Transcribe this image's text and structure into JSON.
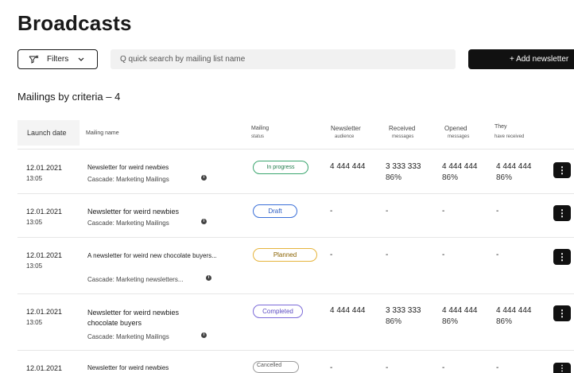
{
  "page": {
    "title": "Broadcasts"
  },
  "toolbar": {
    "filters_label": "Filters",
    "search_placeholder": "Q quick search by mailing list name",
    "add_label": "+ Add newsletter"
  },
  "section": {
    "title": "Mailings by criteria – 4"
  },
  "table": {
    "headers": {
      "launch": "Launch date",
      "name": "Mailing name",
      "status_1": "Mailing",
      "status_2": "status",
      "audience_1": "Newsletter",
      "audience_2": "audience",
      "received_1": "Received",
      "received_2": "messages",
      "opened_1": "Opened",
      "opened_2": "messages",
      "they_1": "They",
      "they_2": "have received"
    },
    "rows": [
      {
        "date": "12.01.2021",
        "time": "13:05",
        "name": "Newsletter for weird newbies",
        "cascade": "Cascade: Marketing Mailings",
        "status": "In progress",
        "audience": "4 444 444",
        "received": "3 333 333",
        "received_pct": "86%",
        "opened": "4 444 444",
        "opened_pct": "86%",
        "they": "4 444 444",
        "they_pct": "86%"
      },
      {
        "date": "12.01.2021",
        "time": "13:05",
        "name": "Newsletter for weird newbies",
        "cascade": "Cascade: Marketing Mailings",
        "status": "Draft",
        "audience": "-",
        "received": "-",
        "opened": "-",
        "they": "-"
      },
      {
        "date": "12.01.2021",
        "time": "13:05",
        "name": "A newsletter for weird new chocolate buyers...",
        "cascade": "Cascade: Marketing newsletters...",
        "status": "Planned",
        "audience": "-",
        "received": "-",
        "opened": "-",
        "they": "-"
      },
      {
        "date": "12.01.2021",
        "time": "13:05",
        "name": "Newsletter for weird newbies",
        "name_2": "chocolate buyers",
        "cascade": "Cascade: Marketing Mailings",
        "status": "Completed",
        "audience": "4 444 444",
        "received": "3 333 333",
        "received_pct": "86%",
        "opened": "4 444 444",
        "opened_pct": "86%",
        "they": "4 444 444",
        "they_pct": "86%"
      },
      {
        "date": "12.01.2021",
        "name": "Newsletter for weird newbies",
        "status": "Cancelled",
        "audience": "-",
        "received": "-",
        "opened": "-",
        "they": "-"
      }
    ]
  },
  "icons": {
    "filter": "filter-icon",
    "chevron": "chevron-down-icon",
    "info": "info-icon",
    "more": "more-vertical-icon"
  },
  "colors": {
    "in_progress": "#3aa56e",
    "draft": "#3a6fd8",
    "planned": "#e6b43c",
    "completed": "#7b6ad8",
    "cancelled": "#999999"
  }
}
